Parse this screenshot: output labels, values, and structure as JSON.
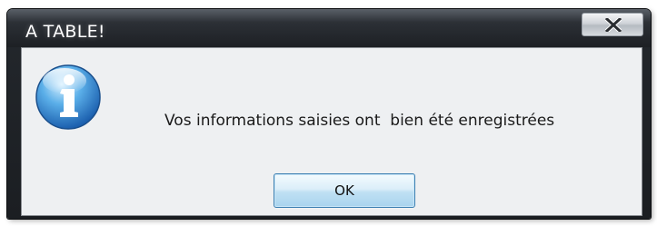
{
  "window": {
    "title": "A TABLE!"
  },
  "dialog": {
    "icon": "information-icon",
    "message": "Vos informations saisies ont  bien été enregistrées",
    "ok_label": "OK"
  },
  "titlebar": {
    "close_icon": "close-icon"
  }
}
